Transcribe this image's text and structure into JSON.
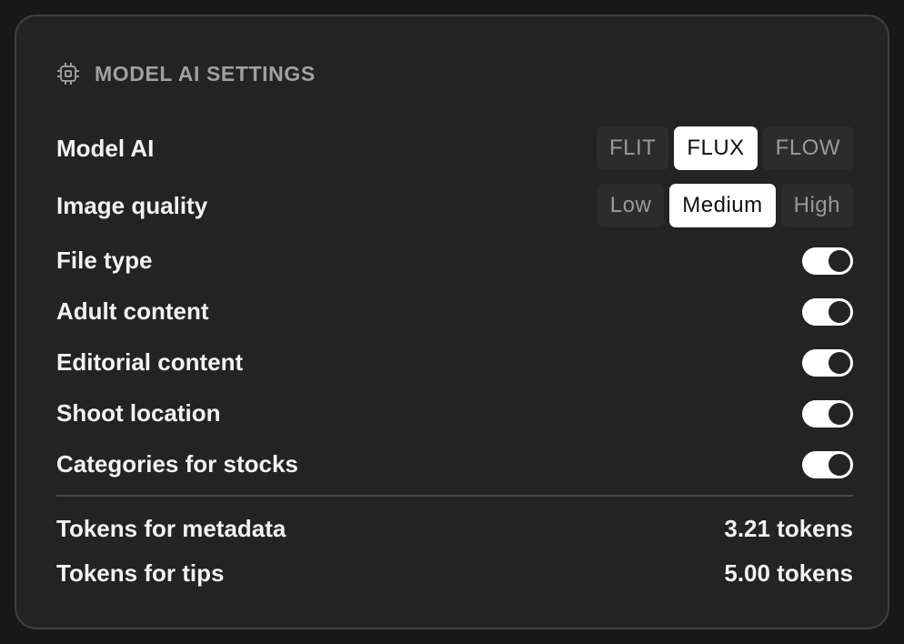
{
  "header": {
    "icon": "chip-icon",
    "title": "MODEL AI SETTINGS"
  },
  "model_ai": {
    "label": "Model AI",
    "options": [
      "FLIT",
      "FLUX",
      "FLOW"
    ],
    "selected": "FLUX"
  },
  "image_quality": {
    "label": "Image quality",
    "options": [
      "Low",
      "Medium",
      "High"
    ],
    "selected": "Medium"
  },
  "toggles": [
    {
      "label": "File type",
      "on": true
    },
    {
      "label": "Adult content",
      "on": true
    },
    {
      "label": "Editorial content",
      "on": true
    },
    {
      "label": "Shoot location",
      "on": true
    },
    {
      "label": "Categories for stocks",
      "on": true
    }
  ],
  "tokens": [
    {
      "label": "Tokens for metadata",
      "value": "3.21 tokens"
    },
    {
      "label": "Tokens for tips",
      "value": "5.00 tokens"
    }
  ],
  "colors": {
    "background": "#181818",
    "panel": "#232323",
    "accent_active": "#ffffff"
  }
}
